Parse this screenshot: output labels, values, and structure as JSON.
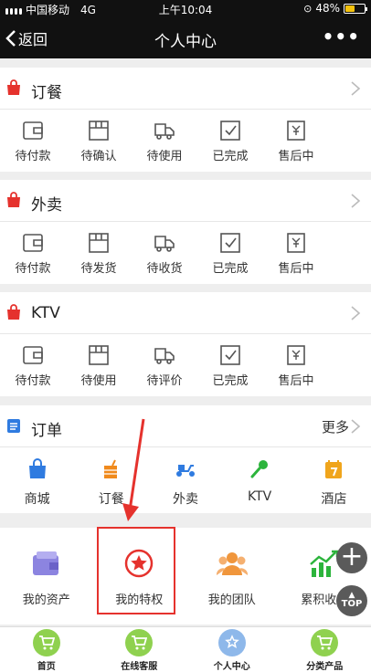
{
  "status": {
    "carrier": "中国移动",
    "network": "4G",
    "time": "上午10:04",
    "battery": "48%",
    "battery_level": 0.48
  },
  "nav": {
    "back_label": "返回",
    "title": "个人中心",
    "more_label": "•••"
  },
  "sections": [
    {
      "title": "订餐",
      "items": [
        "待付款",
        "待确认",
        "待使用",
        "已完成",
        "售后中"
      ]
    },
    {
      "title": "外卖",
      "items": [
        "待付款",
        "待发货",
        "待收货",
        "已完成",
        "售后中"
      ]
    },
    {
      "title": "KTV",
      "items": [
        "待付款",
        "待使用",
        "待评价",
        "已完成",
        "售后中"
      ]
    }
  ],
  "orders": {
    "title": "订单",
    "more": "更多",
    "categories": [
      "商城",
      "订餐",
      "外卖",
      "KTV",
      "酒店"
    ]
  },
  "privileges": {
    "items": [
      "我的资产",
      "我的特权",
      "我的团队",
      "累积收益"
    ]
  },
  "float": {
    "add": "+",
    "top": "TOP"
  },
  "tabbar": {
    "items": [
      "首页",
      "在线客服",
      "个人中心",
      "分类产品"
    ]
  },
  "colors": {
    "accent_red": "#e5322d",
    "tab_green": "#8fd14f",
    "tab_blue": "#8eb8ea",
    "order_blue": "#2f7be0"
  }
}
